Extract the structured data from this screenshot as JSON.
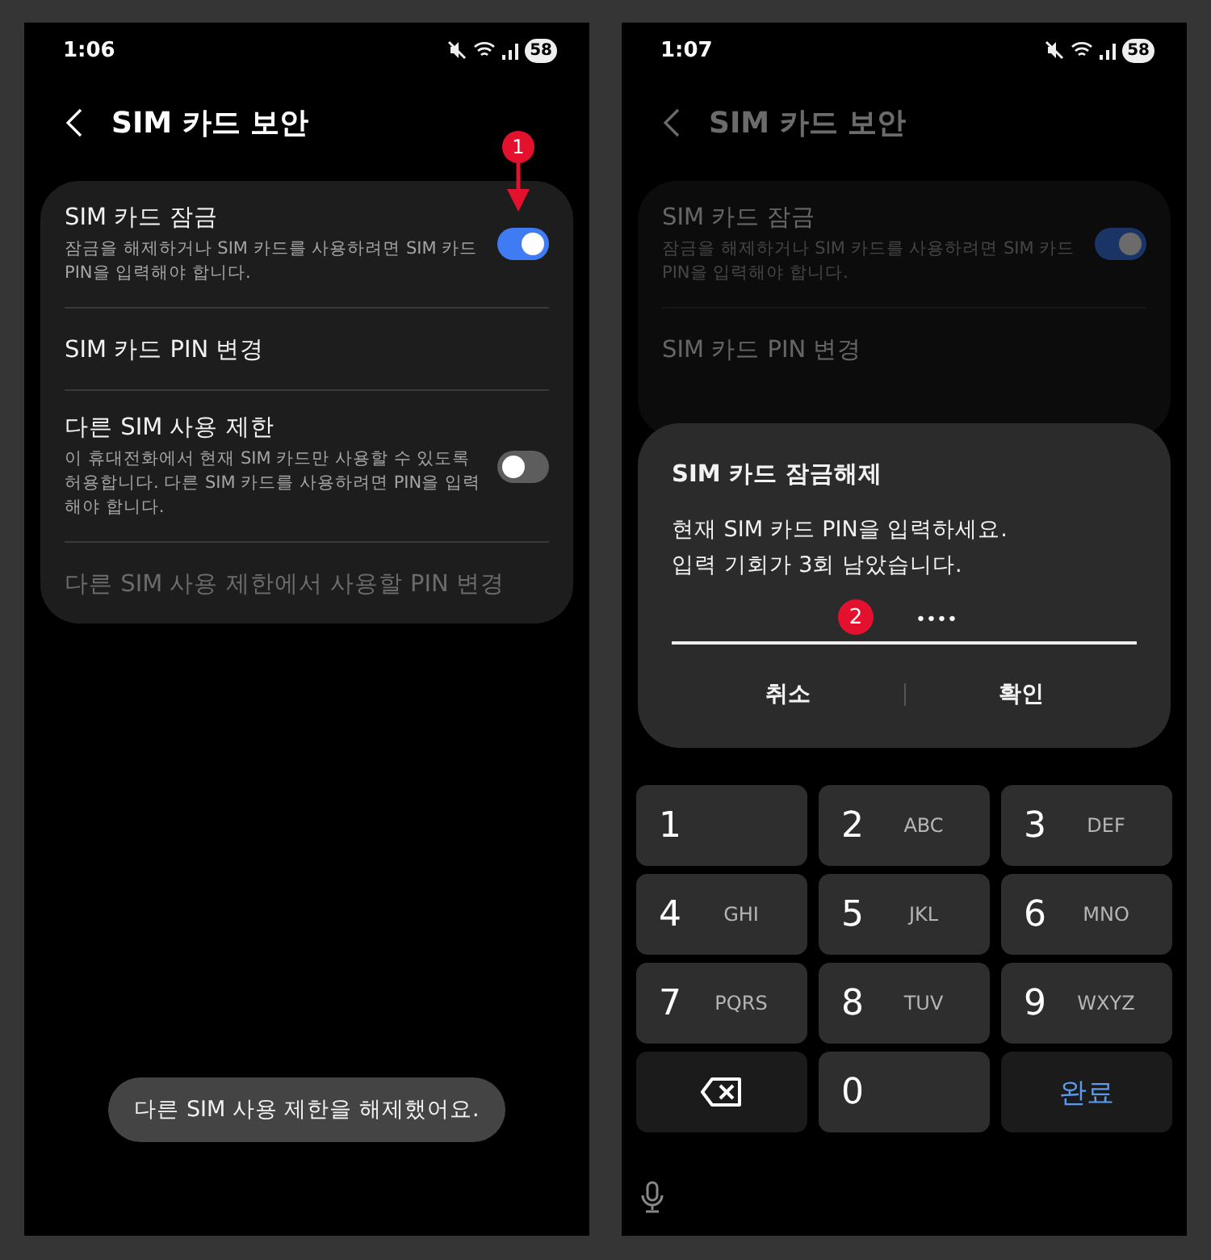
{
  "screens": [
    {
      "status_bar": {
        "time": "1:06",
        "battery": "58"
      },
      "header": {
        "title": "SIM 카드 보안"
      },
      "dimmed": false,
      "settings": [
        {
          "kind": "toggle",
          "label": "SIM 카드 잠금",
          "description": "잠금을 해제하거나 SIM 카드를 사용하려면 SIM 카드 PIN을 입력해야 합니다.",
          "on": true,
          "disabled": false
        },
        {
          "kind": "link",
          "label": "SIM 카드 PIN 변경",
          "disabled": false
        },
        {
          "kind": "toggle",
          "label": "다른 SIM 사용 제한",
          "description": "이 휴대전화에서 현재 SIM 카드만 사용할 수 있도록 허용합니다. 다른 SIM 카드를 사용하려면 PIN을 입력해야 합니다.",
          "on": false,
          "disabled": false
        },
        {
          "kind": "link",
          "label": "다른 SIM 사용 제한에서 사용할 PIN 변경",
          "disabled": true
        }
      ],
      "toast": "다른 SIM 사용 제한을 해제했어요.",
      "annotation": {
        "number": "1",
        "kind": "arrow"
      }
    },
    {
      "status_bar": {
        "time": "1:07",
        "battery": "58"
      },
      "header": {
        "title": "SIM 카드 보안"
      },
      "dimmed": true,
      "settings": [
        {
          "kind": "toggle",
          "label": "SIM 카드 잠금",
          "description": "잠금을 해제하거나 SIM 카드를 사용하려면 SIM 카드 PIN을 입력해야 합니다.",
          "on": true,
          "disabled": false
        },
        {
          "kind": "link",
          "label": "SIM 카드 PIN 변경",
          "disabled": false
        }
      ],
      "dialog": {
        "title": "SIM 카드 잠금해제",
        "message": [
          "현재 SIM 카드 PIN을 입력하세요.",
          "입력 기회가 3회 남았습니다."
        ],
        "pin_value": "••••",
        "annotation": {
          "number": "2",
          "kind": "badge"
        },
        "buttons": [
          "취소",
          "확인"
        ]
      },
      "keypad": {
        "keys": [
          {
            "kind": "digit",
            "digit": "1"
          },
          {
            "kind": "digit",
            "digit": "2",
            "letters": "ABC"
          },
          {
            "kind": "digit",
            "digit": "3",
            "letters": "DEF"
          },
          {
            "kind": "digit",
            "digit": "4",
            "letters": "GHI"
          },
          {
            "kind": "digit",
            "digit": "5",
            "letters": "JKL"
          },
          {
            "kind": "digit",
            "digit": "6",
            "letters": "MNO"
          },
          {
            "kind": "digit",
            "digit": "7",
            "letters": "PQRS"
          },
          {
            "kind": "digit",
            "digit": "8",
            "letters": "TUV"
          },
          {
            "kind": "digit",
            "digit": "9",
            "letters": "WXYZ"
          },
          {
            "kind": "backspace"
          },
          {
            "kind": "digit",
            "digit": "0"
          },
          {
            "kind": "done",
            "label": "완료"
          }
        ]
      }
    }
  ]
}
